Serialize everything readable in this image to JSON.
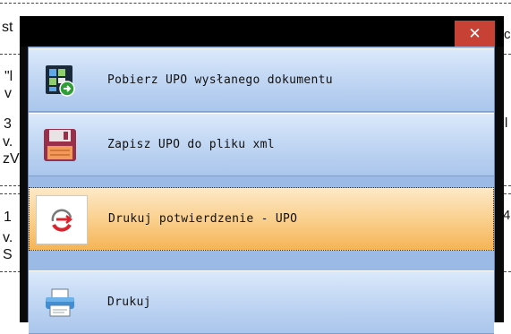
{
  "background": {
    "left_fragments": [
      "st",
      "\"l",
      "v",
      "3",
      "v.",
      "zV",
      "1",
      "v.",
      "S"
    ],
    "right_fragments": [
      "c",
      "l",
      "4"
    ]
  },
  "dialog": {
    "close_label": "✕",
    "items": [
      {
        "label": "Pobierz UPO wysłanego dokumentu",
        "icon": "download-upo-icon",
        "selected": false
      },
      {
        "label": "Zapisz UPO do pliku xml",
        "icon": "save-floppy-icon",
        "selected": false
      },
      {
        "label": "Drukuj potwierdzenie - UPO",
        "icon": "print-confirmation-icon",
        "selected": true
      },
      {
        "label": "Drukuj",
        "icon": "printer-icon",
        "selected": false
      }
    ]
  },
  "colors": {
    "close_button": "#c84135",
    "item_gradient": "#aac6ec",
    "selected_gradient": "#f5b456"
  }
}
